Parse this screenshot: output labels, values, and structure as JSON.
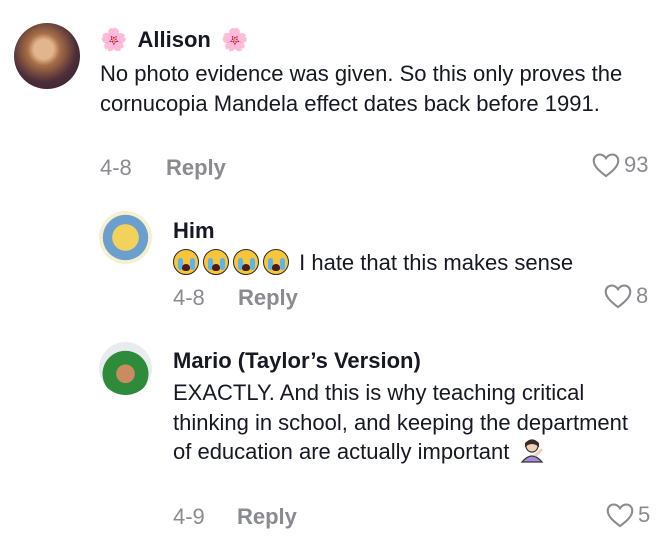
{
  "comments": [
    {
      "author": "Allison",
      "author_decoration": "🌸",
      "text": "No photo evidence was given. So this only proves the cornucopia Mandela effect dates back before 1991.",
      "date": "4-8",
      "reply_label": "Reply",
      "likes": "93"
    },
    {
      "author": "Him",
      "emoji_prefix": [
        "crying-face-icon",
        "crying-face-icon",
        "crying-face-icon",
        "crying-face-icon"
      ],
      "text": "I hate that this makes sense",
      "date": "4-8",
      "reply_label": "Reply",
      "likes": "8"
    },
    {
      "author": "Mario (Taylor’s Version)",
      "text": "EXACTLY. And this is why teaching critical thinking in school, and keeping the department of education are actually important",
      "emoji_suffix": "person-tipping-hand-icon",
      "date": "4-9",
      "reply_label": "Reply",
      "likes": "5"
    }
  ],
  "colors": {
    "text": "#161823",
    "muted": "#8a8b91",
    "flower": "#e0679a"
  }
}
